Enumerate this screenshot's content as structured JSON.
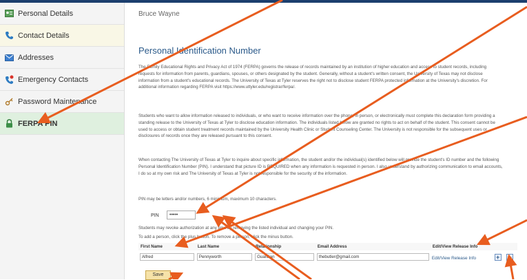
{
  "user": {
    "name": "Bruce Wayne"
  },
  "sidebar": {
    "items": [
      {
        "label": "Personal Details",
        "icon": "person-card-icon"
      },
      {
        "label": "Contact Details",
        "icon": "phone-icon"
      },
      {
        "label": "Addresses",
        "icon": "envelope-icon"
      },
      {
        "label": "Emergency Contacts",
        "icon": "phone-alert-icon"
      },
      {
        "label": "Password Maintenance",
        "icon": "key-icon"
      },
      {
        "label": "FERPA PIN",
        "icon": "lock-icon"
      }
    ],
    "active_index": 5
  },
  "main": {
    "title": "Personal Identification Number",
    "paragraphs": [
      "The Family Educational Rights and Privacy Act of 1974 (FERPA) governs the release of records maintained by an institution of higher education and access to student records, including requests for information from parents, guardians, spouses, or others designated by the student. Generally, without a student's written consent, the University of Texas may not disclose information from a student's educational records. The University of Texas at Tyler reserves the right not to disclose student FERPA protected information at the University's discretion. For additional information regarding FERPA visit https://www.uttyler.edu/registrar/ferpa/.",
      "Students who want to allow information released to individuals, or who want to receive information over the phone, in person, or electronically must complete this declaration form providing a standing release to the University of Texas at Tyler to disclose education information. The individuals listed below are granted no rights to act on behalf of the student. This consent cannot be used to access or obtain student treatment records maintained by the University Health Clinic or Student Counseling Center. The University is not responsible for the subsequent uses or disclosures of records once they are released pursuant to this consent.",
      "When contacting The University of Texas at Tyler to inquire about specific information, the student and/or the individual(s) identified below will provide the student's ID number and the following Personal Identification Number (PIN). I understand that picture ID is REQUIRED when any information is requested in person. I also understand by authorizing communication to email accounts, I do so at my own risk and The University of Texas at Tyler is not responsible for the security of the information."
    ],
    "pin_hint": "PIN may be letters and/or numbers, 6 minimum, maximum 10 characters.",
    "pin_label": "PIN",
    "pin_value": "•••••",
    "revoke_note": "Students may revoke authorization at any time by removing the listed individual and changing your PIN.",
    "add_note": "To add a person, click the plus button. To remove a person, click the minus button.",
    "table": {
      "headers": [
        "First Name",
        "Last Name",
        "Relationship",
        "Email Address",
        "Edit/View Release Info"
      ],
      "rows": [
        {
          "first": "Alfred",
          "last": "Pennyworth",
          "relationship": "Guardian",
          "email": "thebutler@gmail.com",
          "link": "Edit/View Release Info"
        }
      ],
      "add_symbol": "+",
      "remove_symbol": "−"
    },
    "save_label": "Save"
  },
  "colors": {
    "arrow": "#e85d1f",
    "active_nav": "#dff0df",
    "title": "#2b5a8a",
    "save": "#f6e2a8"
  }
}
